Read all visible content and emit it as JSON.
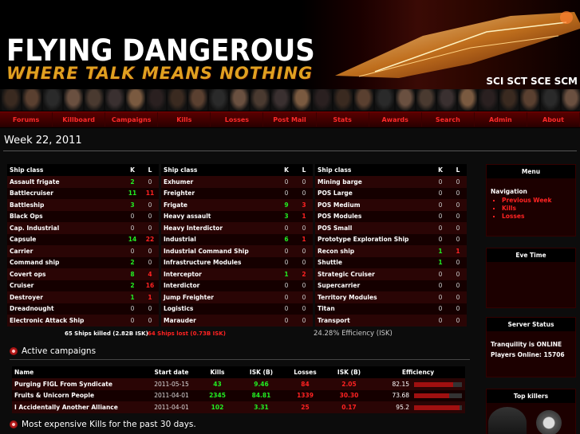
{
  "header": {
    "title": "FLYING DANGEROUS",
    "subtitle": "WHERE TALK MEANS NOTHING",
    "corp_links": [
      "SCI",
      "SCT",
      "SCE",
      "SCM"
    ]
  },
  "nav": [
    "Forums",
    "Killboard",
    "Campaigns",
    "Kills",
    "Losses",
    "Post Mail",
    "Stats",
    "Awards",
    "Search",
    "Admin",
    "About"
  ],
  "week_title": "Week 22, 2011",
  "ship_columns": {
    "ship_class": "Ship class",
    "k": "K",
    "l": "L"
  },
  "ship_tables": [
    [
      {
        "name": "Assault frigate",
        "k": "2",
        "l": "0"
      },
      {
        "name": "Battlecruiser",
        "k": "11",
        "l": "11"
      },
      {
        "name": "Battleship",
        "k": "3",
        "l": "0"
      },
      {
        "name": "Black Ops",
        "k": "0",
        "l": "0"
      },
      {
        "name": "Cap. Industrial",
        "k": "0",
        "l": "0"
      },
      {
        "name": "Capsule",
        "k": "14",
        "l": "22"
      },
      {
        "name": "Carrier",
        "k": "0",
        "l": "0"
      },
      {
        "name": "Command ship",
        "k": "2",
        "l": "0"
      },
      {
        "name": "Covert ops",
        "k": "8",
        "l": "4"
      },
      {
        "name": "Cruiser",
        "k": "2",
        "l": "16"
      },
      {
        "name": "Destroyer",
        "k": "1",
        "l": "1"
      },
      {
        "name": "Dreadnought",
        "k": "0",
        "l": "0"
      },
      {
        "name": "Electronic Attack Ship",
        "k": "0",
        "l": "0"
      }
    ],
    [
      {
        "name": "Exhumer",
        "k": "0",
        "l": "0"
      },
      {
        "name": "Freighter",
        "k": "0",
        "l": "0"
      },
      {
        "name": "Frigate",
        "k": "9",
        "l": "3"
      },
      {
        "name": "Heavy assault",
        "k": "3",
        "l": "1"
      },
      {
        "name": "Heavy Interdictor",
        "k": "0",
        "l": "0"
      },
      {
        "name": "Industrial",
        "k": "6",
        "l": "1"
      },
      {
        "name": "Industrial Command Ship",
        "k": "0",
        "l": "0"
      },
      {
        "name": "Infrastructure Modules",
        "k": "0",
        "l": "0"
      },
      {
        "name": "Interceptor",
        "k": "1",
        "l": "2"
      },
      {
        "name": "Interdictor",
        "k": "0",
        "l": "0"
      },
      {
        "name": "Jump Freighter",
        "k": "0",
        "l": "0"
      },
      {
        "name": "Logistics",
        "k": "0",
        "l": "0"
      },
      {
        "name": "Marauder",
        "k": "0",
        "l": "0"
      }
    ],
    [
      {
        "name": "Mining barge",
        "k": "0",
        "l": "0"
      },
      {
        "name": "POS Large",
        "k": "0",
        "l": "0"
      },
      {
        "name": "POS Medium",
        "k": "0",
        "l": "0"
      },
      {
        "name": "POS Modules",
        "k": "0",
        "l": "0"
      },
      {
        "name": "POS Small",
        "k": "0",
        "l": "0"
      },
      {
        "name": "Prototype Exploration Ship",
        "k": "0",
        "l": "0"
      },
      {
        "name": "Recon ship",
        "k": "1",
        "l": "1"
      },
      {
        "name": "Shuttle",
        "k": "1",
        "l": "0"
      },
      {
        "name": "Strategic Cruiser",
        "k": "0",
        "l": "0"
      },
      {
        "name": "Supercarrier",
        "k": "0",
        "l": "0"
      },
      {
        "name": "Territory Modules",
        "k": "0",
        "l": "0"
      },
      {
        "name": "Titan",
        "k": "0",
        "l": "0"
      },
      {
        "name": "Transport",
        "k": "0",
        "l": "0"
      }
    ]
  ],
  "summary": {
    "kills": "65 Ships killed (2.82B ISK)",
    "lost": "64 Ships lost (0.73B ISK)",
    "efficiency": "24.28% Efficiency (ISK)"
  },
  "campaigns": {
    "heading": "Active campaigns",
    "columns": [
      "Name",
      "Start date",
      "Kills",
      "ISK (B)",
      "Losses",
      "ISK (B)",
      "Efficiency"
    ],
    "rows": [
      {
        "name": "Purging FIGL From Syndicate",
        "start": "2011-05-15",
        "kills": "43",
        "kills_isk": "9.46",
        "losses": "84",
        "losses_isk": "2.05",
        "eff": "82.15",
        "eff_frac": 0.8215
      },
      {
        "name": "Fruits & Unicorn People",
        "start": "2011-04-01",
        "kills": "2345",
        "kills_isk": "84.81",
        "losses": "1339",
        "losses_isk": "30.30",
        "eff": "73.68",
        "eff_frac": 0.7368
      },
      {
        "name": "I Accidentally Another Alliance",
        "start": "2011-04-01",
        "kills": "102",
        "kills_isk": "3.31",
        "losses": "25",
        "losses_isk": "0.17",
        "eff": "95.2",
        "eff_frac": 0.952
      }
    ]
  },
  "expensive_heading": "Most expensive Kills for the past 30 days.",
  "sidebar": {
    "menu_title": "Menu",
    "nav_label": "Navigation",
    "nav_items": [
      "Previous Week",
      "Kills",
      "Losses"
    ],
    "evetime_title": "Eve Time",
    "status_title": "Server Status",
    "status_line1": "Tranquility is ONLINE",
    "status_line2": "Players Online: 15706",
    "topkillers_title": "Top killers"
  }
}
